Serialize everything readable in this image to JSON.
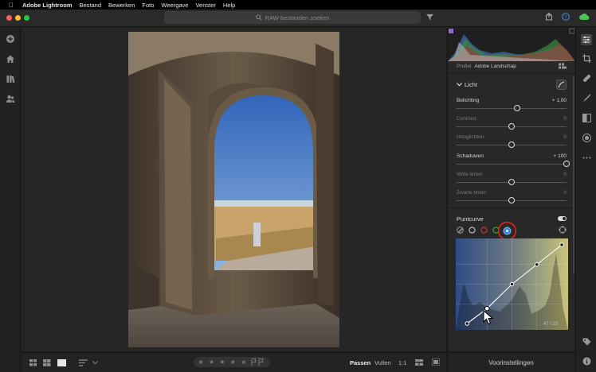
{
  "menubar": {
    "apple": "",
    "app_name": "Adobe Lightroom",
    "items": [
      "Bestand",
      "Bewerken",
      "Foto",
      "Weergave",
      "Venster",
      "Help"
    ]
  },
  "search": {
    "placeholder": "RAW-bestanden zoeken"
  },
  "colors": {
    "accent": "#3f7fd6",
    "panel_bg": "#282828",
    "circle_highlight": "#e0241b"
  },
  "panel": {
    "profile_label": "Profiel",
    "profile_value": "Adobe Landschap",
    "section_title": "Licht",
    "sliders": [
      {
        "label": "Belichting",
        "value": "+ 1,00",
        "amount": 0.1,
        "active": true
      },
      {
        "label": "Contrast",
        "value": "0",
        "amount": 0.0,
        "active": false
      },
      {
        "label": "Hooglichten",
        "value": "0",
        "amount": 0.0,
        "active": false
      },
      {
        "label": "Schaduwen",
        "value": "+ 100",
        "amount": 1.0,
        "active": true
      },
      {
        "label": "Witte tinten",
        "value": "0",
        "amount": 0.0,
        "active": false
      },
      {
        "label": "Zwarte tinten",
        "value": "0",
        "amount": 0.0,
        "active": false
      }
    ],
    "curve_title": "Puntcurve",
    "curve_readout": "47 / 23",
    "curve_points": [
      [
        0.05,
        0.0
      ],
      [
        0.25,
        0.19
      ],
      [
        0.5,
        0.5
      ],
      [
        0.75,
        0.75
      ],
      [
        1.0,
        1.0
      ]
    ]
  },
  "bottom": {
    "stars": "★ ★ ★ ★ ★",
    "fit": "Passen",
    "fill": "Vullen",
    "ratio": "1:1"
  },
  "presets_label": "Voorinstellingen"
}
